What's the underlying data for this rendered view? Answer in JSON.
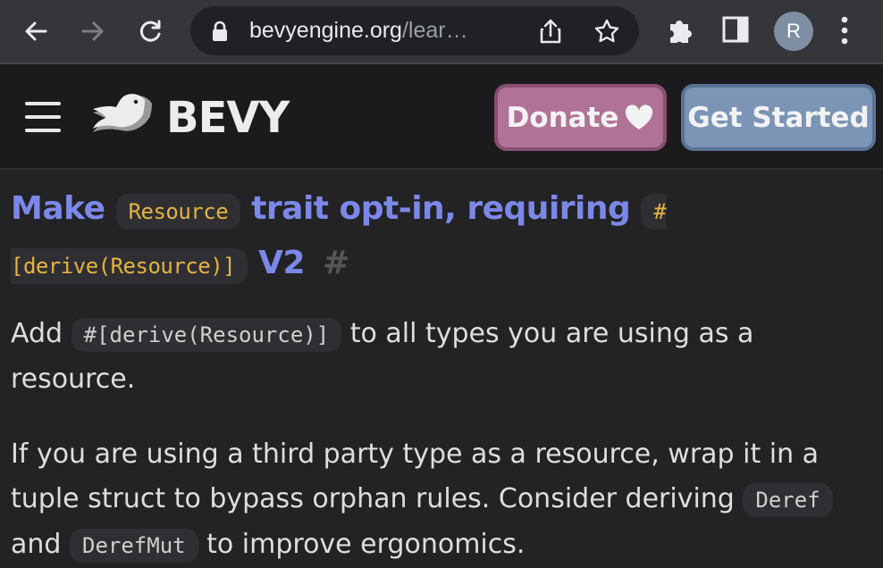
{
  "browser": {
    "url_host": "bevyengine.org",
    "url_path": "/lear…",
    "avatar_letter": "R",
    "icons": [
      "back-icon",
      "forward-icon",
      "reload-icon",
      "lock-icon",
      "share-icon",
      "star-icon",
      "puzzle-icon",
      "side-panel-icon",
      "kebab-menu-icon"
    ]
  },
  "header": {
    "logo_text": "BEVY",
    "donate_label": "Donate",
    "get_started_label": "Get Started"
  },
  "article": {
    "title_part1": "Make",
    "title_code1": "Resource",
    "title_part2": "trait opt-in, requiring",
    "title_code2": "#[derive(Resource)]",
    "title_part3": "V2",
    "anchor": "#",
    "p1_a": "Add",
    "p1_code": "#[derive(Resource)]",
    "p1_b": "to all types you are using as a resource.",
    "p2_a": "If you are using a third party type as a resource, wrap it in a tuple struct to bypass orphan rules. Consider deriving",
    "p2_code1": "Deref",
    "p2_b": "and",
    "p2_code2": "DerefMut",
    "p2_c": "to improve ergonomics."
  },
  "colors": {
    "title": "#7b88e8",
    "code_title": "#e3b341",
    "donate_bg": "#b07396",
    "get_started_bg": "#7c94b6"
  }
}
